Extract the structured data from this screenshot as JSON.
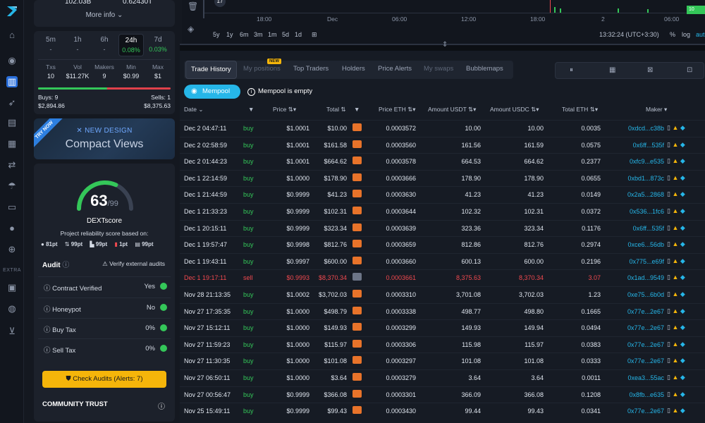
{
  "left_panel": {
    "top_values": [
      "102.03B",
      "0.62430T"
    ],
    "more_info_label": "More info",
    "timeframes": [
      {
        "label": "5m",
        "change": "-"
      },
      {
        "label": "1h",
        "change": "-"
      },
      {
        "label": "6h",
        "change": "-"
      },
      {
        "label": "24h",
        "change": "0.08%",
        "selected": true
      },
      {
        "label": "7d",
        "change": "0.03%"
      }
    ],
    "mini_stats": [
      {
        "label": "Txs",
        "value": "10"
      },
      {
        "label": "Vol",
        "value": "$11.27K"
      },
      {
        "label": "Makers",
        "value": "9"
      },
      {
        "label": "Min",
        "value": "$0.99"
      },
      {
        "label": "Max",
        "value": "$1"
      }
    ],
    "buys_label": "Buys: 9",
    "buys_value": "$2,894.86",
    "sells_label": "Sells: 1",
    "sells_value": "$8,375.63",
    "buy_fraction": 0.52,
    "promo": {
      "ribbon": "TRY NOW",
      "new_design": "NEW DESIGN",
      "title": "Compact Views"
    },
    "score": {
      "value": "63",
      "max": "/99",
      "name": "DEXTscore",
      "subtitle": "Project reliability score based on:",
      "points": [
        "81pt",
        "99pt",
        "99pt",
        "1pt",
        "99pt"
      ]
    },
    "audit": {
      "title": "Audit",
      "verify_label": "Verify external audits",
      "rows": [
        {
          "name": "Contract Verified",
          "result": "Yes"
        },
        {
          "name": "Honeypot",
          "result": "No"
        },
        {
          "name": "Buy Tax",
          "result": "0%"
        },
        {
          "name": "Sell Tax",
          "result": "0%"
        }
      ],
      "check_button": "Check Audits  (Alerts: 7)"
    },
    "community_label": "COMMUNITY TRUST"
  },
  "chart": {
    "times": [
      "18:00",
      "Dec",
      "06:00",
      "12:00",
      "18:00",
      "2",
      "06:00"
    ],
    "ranges": [
      "5y",
      "1y",
      "6m",
      "3m",
      "1m",
      "5d",
      "1d"
    ],
    "clock": "13:32:24 (UTC+3:30)",
    "controls": [
      "%",
      "log",
      "auto"
    ],
    "price_marker": "10"
  },
  "rail": {
    "extra_label": "EXTRA"
  },
  "tabs": {
    "items": [
      "Trade History",
      "My positions",
      "Top Traders",
      "Holders",
      "Price Alerts",
      "My swaps",
      "Bubblemaps"
    ],
    "new_badge": "NEW"
  },
  "mempool": {
    "button": "Mempool",
    "status": "Mempool is empty"
  },
  "table": {
    "headers": [
      "Date",
      "Price",
      "Total",
      "Price ETH",
      "Amount USDT",
      "Amount USDC",
      "Total ETH",
      "Maker"
    ],
    "rows": [
      {
        "date": "Dec 2 04:47:11",
        "type": "buy",
        "price": "$1.0001",
        "total": "$10.00",
        "price_eth": "0.0003572",
        "usdt": "10.00",
        "usdc": "10.00",
        "total_eth": "0.0035",
        "maker": "0xdcd...c38b"
      },
      {
        "date": "Dec 2 02:58:59",
        "type": "buy",
        "price": "$1.0001",
        "total": "$161.58",
        "price_eth": "0.0003560",
        "usdt": "161.56",
        "usdc": "161.59",
        "total_eth": "0.0575",
        "maker": "0x6ff...535f"
      },
      {
        "date": "Dec 2 01:44:23",
        "type": "buy",
        "price": "$1.0001",
        "total": "$664.62",
        "price_eth": "0.0003578",
        "usdt": "664.53",
        "usdc": "664.62",
        "total_eth": "0.2377",
        "maker": "0xfc9...e535"
      },
      {
        "date": "Dec 1 22:14:59",
        "type": "buy",
        "price": "$1.0000",
        "total": "$178.90",
        "price_eth": "0.0003666",
        "usdt": "178.90",
        "usdc": "178.90",
        "total_eth": "0.0655",
        "maker": "0xbd1...873c"
      },
      {
        "date": "Dec 1 21:44:59",
        "type": "buy",
        "price": "$0.9999",
        "total": "$41.23",
        "price_eth": "0.0003630",
        "usdt": "41.23",
        "usdc": "41.23",
        "total_eth": "0.0149",
        "maker": "0x2a5...2868"
      },
      {
        "date": "Dec 1 21:33:23",
        "type": "buy",
        "price": "$0.9999",
        "total": "$102.31",
        "price_eth": "0.0003644",
        "usdt": "102.32",
        "usdc": "102.31",
        "total_eth": "0.0372",
        "maker": "0x536...1fc6"
      },
      {
        "date": "Dec 1 20:15:11",
        "type": "buy",
        "price": "$0.9999",
        "total": "$323.34",
        "price_eth": "0.0003639",
        "usdt": "323.36",
        "usdc": "323.34",
        "total_eth": "0.1176",
        "maker": "0x6ff...535f"
      },
      {
        "date": "Dec 1 19:57:47",
        "type": "buy",
        "price": "$0.9998",
        "total": "$812.76",
        "price_eth": "0.0003659",
        "usdt": "812.86",
        "usdc": "812.76",
        "total_eth": "0.2974",
        "maker": "0xce6...56db"
      },
      {
        "date": "Dec 1 19:43:11",
        "type": "buy",
        "price": "$0.9997",
        "total": "$600.00",
        "price_eth": "0.0003660",
        "usdt": "600.13",
        "usdc": "600.00",
        "total_eth": "0.2196",
        "maker": "0x775...e69f"
      },
      {
        "date": "Dec 1 19:17:11",
        "type": "sell",
        "price": "$0.9993",
        "total": "$8,370.34",
        "price_eth": "0.0003661",
        "usdt": "8,375.63",
        "usdc": "8,370.34",
        "total_eth": "3.07",
        "maker": "0x1ad...9549"
      },
      {
        "date": "Nov 28 21:13:35",
        "type": "buy",
        "price": "$1.0002",
        "total": "$3,702.03",
        "price_eth": "0.0003310",
        "usdt": "3,701.08",
        "usdc": "3,702.03",
        "total_eth": "1.23",
        "maker": "0xe75...6b0d"
      },
      {
        "date": "Nov 27 17:35:35",
        "type": "buy",
        "price": "$1.0000",
        "total": "$498.79",
        "price_eth": "0.0003338",
        "usdt": "498.77",
        "usdc": "498.80",
        "total_eth": "0.1665",
        "maker": "0x77e...2e67"
      },
      {
        "date": "Nov 27 15:12:11",
        "type": "buy",
        "price": "$1.0000",
        "total": "$149.93",
        "price_eth": "0.0003299",
        "usdt": "149.93",
        "usdc": "149.94",
        "total_eth": "0.0494",
        "maker": "0x77e...2e67"
      },
      {
        "date": "Nov 27 11:59:23",
        "type": "buy",
        "price": "$1.0000",
        "total": "$115.97",
        "price_eth": "0.0003306",
        "usdt": "115.98",
        "usdc": "115.97",
        "total_eth": "0.0383",
        "maker": "0x77e...2e67"
      },
      {
        "date": "Nov 27 11:30:35",
        "type": "buy",
        "price": "$1.0000",
        "total": "$101.08",
        "price_eth": "0.0003297",
        "usdt": "101.08",
        "usdc": "101.08",
        "total_eth": "0.0333",
        "maker": "0x77e...2e67"
      },
      {
        "date": "Nov 27 06:50:11",
        "type": "buy",
        "price": "$1.0000",
        "total": "$3.64",
        "price_eth": "0.0003279",
        "usdt": "3.64",
        "usdc": "3.64",
        "total_eth": "0.0011",
        "maker": "0xea3...55ac"
      },
      {
        "date": "Nov 27 00:56:47",
        "type": "buy",
        "price": "$0.9999",
        "total": "$366.08",
        "price_eth": "0.0003301",
        "usdt": "366.09",
        "usdc": "366.08",
        "total_eth": "0.1208",
        "maker": "0x8fb...e635"
      },
      {
        "date": "Nov 25 15:49:11",
        "type": "buy",
        "price": "$0.9999",
        "total": "$99.43",
        "price_eth": "0.0003430",
        "usdt": "99.44",
        "usdc": "99.43",
        "total_eth": "0.0341",
        "maker": "0x77e...2e67"
      }
    ]
  },
  "colors": {
    "accent": "#26b6e8",
    "buy": "#34c759",
    "sell": "#f0494f",
    "warning": "#f5b50a"
  }
}
